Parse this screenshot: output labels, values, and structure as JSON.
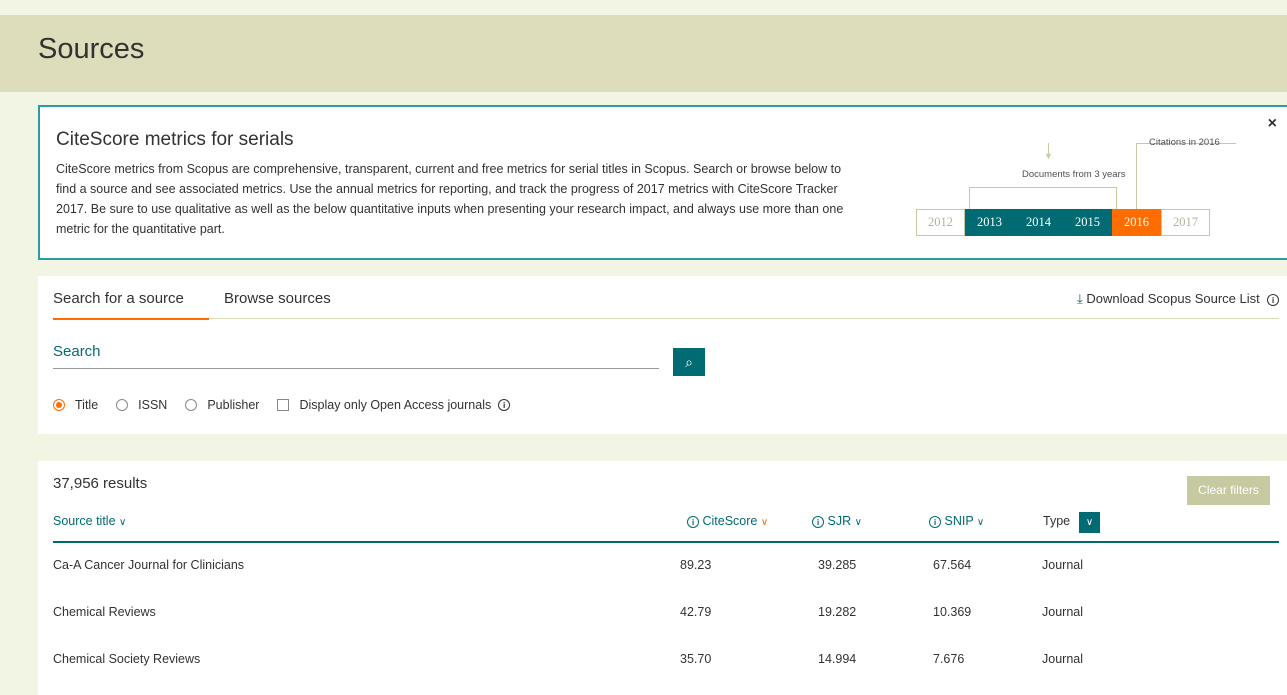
{
  "header": {
    "title": "Sources"
  },
  "info": {
    "title": "CiteScore metrics for serials",
    "body": "CiteScore metrics from Scopus are comprehensive, transparent, current and free metrics for serial titles in Scopus. Search or browse below to find a source and see associated metrics. Use the annual metrics for reporting, and track the progress of 2017 metrics with CiteScore Tracker 2017. Be sure to use qualitative as well as the below quantitative inputs when presenting your research impact, and always use more than one metric for the quantitative part.",
    "close_label": "×",
    "diagram": {
      "citations_label": "Citations in 2016",
      "documents_label": "Documents from 3 years",
      "years": [
        "2012",
        "2013",
        "2014",
        "2015",
        "2016",
        "2017"
      ]
    }
  },
  "tabs": [
    {
      "label": "Search for a source",
      "active": true
    },
    {
      "label": "Browse sources",
      "active": false
    }
  ],
  "download": {
    "label": "Download Scopus Source List"
  },
  "search": {
    "label": "Search",
    "value": "",
    "options": [
      {
        "label": "Title",
        "checked": true
      },
      {
        "label": "ISSN",
        "checked": false
      },
      {
        "label": "Publisher",
        "checked": false
      }
    ],
    "open_access_label": "Display only Open Access journals"
  },
  "results": {
    "count": "37,956 results",
    "clear_filters": "Clear filters",
    "columns": [
      "Source title",
      "CiteScore",
      "SJR",
      "SNIP",
      "Type"
    ],
    "rows": [
      {
        "title": "Ca-A Cancer Journal for Clinicians",
        "citescore": "89.23",
        "sjr": "39.285",
        "snip": "67.564",
        "type": "Journal"
      },
      {
        "title": "Chemical Reviews",
        "citescore": "42.79",
        "sjr": "19.282",
        "snip": "10.369",
        "type": "Journal"
      },
      {
        "title": "Chemical Society Reviews",
        "citescore": "35.70",
        "sjr": "14.994",
        "snip": "7.676",
        "type": "Journal"
      }
    ]
  },
  "colors": {
    "teal": "#006b72",
    "orange": "#ff6c00",
    "header_bg": "#dddcbb",
    "page_bg": "#f2f4e4"
  }
}
